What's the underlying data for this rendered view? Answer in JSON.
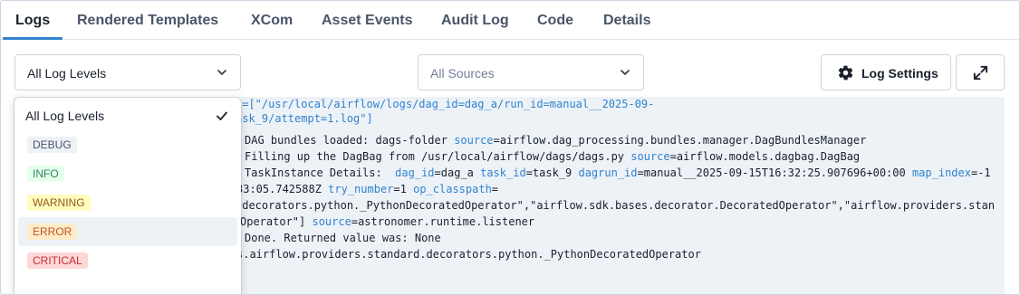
{
  "tabs": [
    {
      "label": "Logs",
      "active": true
    },
    {
      "label": "Rendered Templates"
    },
    {
      "label": "XCom"
    },
    {
      "label": "Asset Events"
    },
    {
      "label": "Audit Log"
    },
    {
      "label": "Code"
    },
    {
      "label": "Details"
    }
  ],
  "toolbar": {
    "log_level_value": "All Log Levels",
    "sources_placeholder": "All Sources",
    "log_settings_label": "Log Settings",
    "log_settings_icon": "gear-icon",
    "fullscreen_icon": "expand-icon"
  },
  "dropdown": {
    "options": [
      {
        "label": "All Log Levels",
        "selected": true
      },
      {
        "label": "DEBUG",
        "color": "#4a5568",
        "bg": "#edf2f7"
      },
      {
        "label": "INFO",
        "color": "#2f855a",
        "bg": "#e6ffed"
      },
      {
        "label": "WARNING",
        "color": "#975a16",
        "bg": "#fefcbf"
      },
      {
        "label": "ERROR",
        "color": "#c05621",
        "bg": "#feebc8",
        "hovered": true
      },
      {
        "label": "CRITICAL",
        "color": "#c53030",
        "bg": "#fed7d7"
      }
    ]
  },
  "log": {
    "line1a": "s=[\"/usr/local/airflow/logs/dag_id=dag_a/run_id=manual__2025-09-",
    "line1b": "ask_9/attempt=1.log\"]",
    "line2_text": "DAG bundles loaded: dags-folder ",
    "line2_key": "source",
    "line2_val": "=airflow.dag_processing.bundles.manager.DagBundlesManager",
    "line3_text": "Filling up the DagBag from /usr/local/airflow/dags/dags.py ",
    "line3_key": "source",
    "line3_val": "=airflow.models.dagbag.DagBag",
    "line4_text": "TaskInstance Details:  ",
    "line4_k1": "dag_id",
    "line4_v1": "=dag_a ",
    "line4_k2": "task_id",
    "line4_v2": "=task_9 ",
    "line4_k3": "dagrun_id",
    "line4_v3": "=manual__2025-09-15T16:32:25.907696+00:00 ",
    "line4_k4": "map_index",
    "line4_v4": "=-1",
    "line5_text": "33:05.742588Z ",
    "line5_k1": "try_number",
    "line5_v1": "=1 ",
    "line5_k2": "op_classpath",
    "line5_v2": "=",
    "line6": ".decorators.python._PythonDecoratedOperator\",\"airflow.sdk.bases.decorator.DecoratedOperator\",\"airflow.providers.stan",
    "line7_text": "Operator\"] ",
    "line7_key": "source",
    "line7_val": "=astronomer.runtime.listener",
    "line8": "Done. Returned value was: None",
    "line9": "s.airflow.providers.standard.decorators.python._PythonDecoratedOperator"
  }
}
